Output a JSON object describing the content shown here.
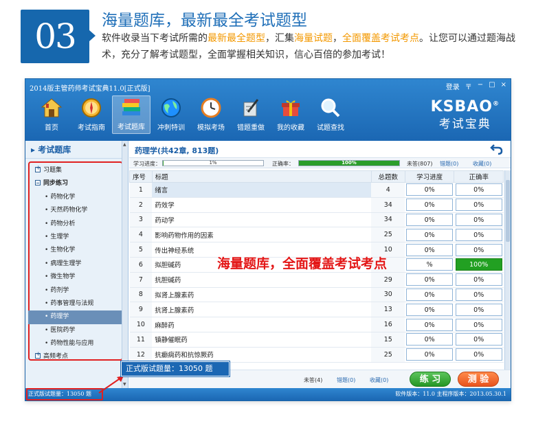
{
  "promo": {
    "badge_number": "03",
    "title": "海量题库，最新最全考试题型",
    "desc_1": "软件收录当下考试所需的",
    "desc_hl1": "最新最全题型",
    "desc_2": "，汇集",
    "desc_hl2": "海量试题",
    "desc_3": "，",
    "desc_hl3": "全面覆盖考试考点",
    "desc_4": "。让您可以通过题海战术，充分了解考试题型，全面掌握相关知识，信心百倍的参加考试！",
    "accent_color": "#1667ad",
    "highlight_color": "#f39800"
  },
  "window": {
    "title": "2014版主管药师考试宝典11.0[正式版]",
    "controls": {
      "login": "登录",
      "menu": "〒",
      "min": "−",
      "max": "□",
      "close": "×"
    }
  },
  "toolbar": {
    "items": [
      {
        "label": "首页",
        "icon": "home-icon"
      },
      {
        "label": "考试指南",
        "icon": "compass-icon"
      },
      {
        "label": "考试题库",
        "icon": "books-icon",
        "active": true
      },
      {
        "label": "冲刺特训",
        "icon": "globe-icon"
      },
      {
        "label": "模拟考场",
        "icon": "clock-icon"
      },
      {
        "label": "错题重做",
        "icon": "pen-icon"
      },
      {
        "label": "我的收藏",
        "icon": "gift-icon"
      },
      {
        "label": "试题查找",
        "icon": "magnifier-icon"
      }
    ]
  },
  "logo": {
    "en": "KSBAO",
    "reg": "®",
    "cn": "考试宝典"
  },
  "sidebar": {
    "header": "考试题库",
    "nodes": [
      {
        "label": "习题集",
        "type": "group",
        "state": "plus"
      },
      {
        "label": "同步练习",
        "type": "group",
        "state": "minus",
        "bold": true
      },
      {
        "label": "药物化学",
        "type": "leaf"
      },
      {
        "label": "天然药物化学",
        "type": "leaf"
      },
      {
        "label": "药物分析",
        "type": "leaf"
      },
      {
        "label": "生理学",
        "type": "leaf"
      },
      {
        "label": "生物化学",
        "type": "leaf"
      },
      {
        "label": "病理生理学",
        "type": "leaf"
      },
      {
        "label": "微生物学",
        "type": "leaf"
      },
      {
        "label": "药剂学",
        "type": "leaf"
      },
      {
        "label": "药事管理与法规",
        "type": "leaf"
      },
      {
        "label": "药理学",
        "type": "leaf",
        "selected": true
      },
      {
        "label": "医院药学",
        "type": "leaf"
      },
      {
        "label": "药物性能与应用",
        "type": "leaf"
      },
      {
        "label": "高频考点",
        "type": "group",
        "state": "plus"
      }
    ]
  },
  "main": {
    "subject_title": "药理学(共42章, 813题)",
    "study_progress_label": "学习进度：",
    "study_progress_value": "1%",
    "study_progress_fraction": 0.01,
    "accuracy_label": "正确率：",
    "accuracy_value": "100%",
    "accuracy_fraction": 1.0,
    "unanswered": "未答(807)",
    "wrong": "错题(0)",
    "favorites": "收藏(0)",
    "columns": {
      "index": "序号",
      "title": "标题",
      "total": "总题数",
      "progress": "学习进度",
      "accuracy": "正确率"
    },
    "rows": [
      {
        "index": "1",
        "title": "绪言",
        "total": "4",
        "progress": "0%",
        "accuracy": "0%"
      },
      {
        "index": "2",
        "title": "药效学",
        "total": "34",
        "progress": "0%",
        "accuracy": "0%"
      },
      {
        "index": "3",
        "title": "药动学",
        "total": "34",
        "progress": "0%",
        "accuracy": "0%"
      },
      {
        "index": "4",
        "title": "影响药物作用的因素",
        "total": "25",
        "progress": "0%",
        "accuracy": "0%"
      },
      {
        "index": "5",
        "title": "传出神经系统",
        "total": "10",
        "progress": "0%",
        "accuracy": "0%"
      },
      {
        "index": "6",
        "title": "拟胆碱药",
        "total": "",
        "progress": "%",
        "accuracy": "100%",
        "accuracy_green": true
      },
      {
        "index": "7",
        "title": "抗胆碱药",
        "total": "29",
        "progress": "0%",
        "accuracy": "0%"
      },
      {
        "index": "8",
        "title": "拟肾上腺素药",
        "total": "30",
        "progress": "0%",
        "accuracy": "0%"
      },
      {
        "index": "9",
        "title": "抗肾上腺素药",
        "total": "13",
        "progress": "0%",
        "accuracy": "0%"
      },
      {
        "index": "10",
        "title": "麻醉药",
        "total": "16",
        "progress": "0%",
        "accuracy": "0%"
      },
      {
        "index": "11",
        "title": "镇静催眠药",
        "total": "15",
        "progress": "0%",
        "accuracy": "0%"
      },
      {
        "index": "12",
        "title": "抗癫痫药和抗惊厥药",
        "total": "25",
        "progress": "0%",
        "accuracy": "0%"
      }
    ],
    "overlay": "海量题库，全面覆盖考试考点",
    "bottom": {
      "unanswered": "未答(4)",
      "wrong": "错题(0)",
      "favorites": "收藏(0)",
      "practice": "练 习",
      "test": "测 验"
    }
  },
  "statusbar": {
    "left": "正式版试题量：13050 题",
    "right": "软件版本：11.0 主程序版本：2013.05.30.1"
  },
  "callout": "正式版试题量：13050 题"
}
